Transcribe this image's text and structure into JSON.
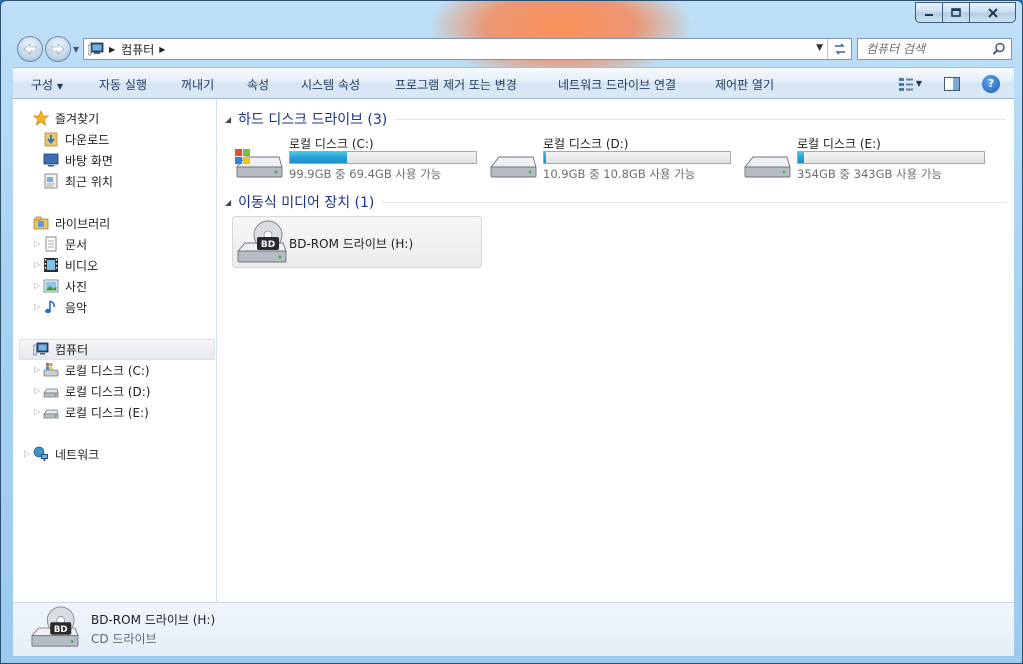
{
  "window": {
    "caption": {
      "minimize_icon": "minimize-icon",
      "maximize_icon": "maximize-icon",
      "close_icon": "close-icon"
    }
  },
  "address_bar": {
    "location": "컴퓨터",
    "icon": "computer-icon"
  },
  "search": {
    "placeholder": "컴퓨터 검색"
  },
  "toolbar": {
    "organize": "구성",
    "autoplay": "자동 실행",
    "eject": "꺼내기",
    "properties": "속성",
    "system_properties": "시스템 속성",
    "uninstall": "프로그램 제거 또는 변경",
    "map_network_drive": "네트워크 드라이브 연결",
    "control_panel": "제어판 열기"
  },
  "nav": {
    "favorites": {
      "label": "즐겨찾기",
      "items": [
        "다운로드",
        "바탕 화면",
        "최근 위치"
      ]
    },
    "libraries": {
      "label": "라이브러리",
      "items": [
        "문서",
        "비디오",
        "사진",
        "음악"
      ]
    },
    "computer": {
      "label": "컴퓨터",
      "items": [
        "로컬 디스크 (C:)",
        "로컬 디스크 (D:)",
        "로컬 디스크 (E:)"
      ]
    },
    "network": {
      "label": "네트워크"
    }
  },
  "groups": {
    "hard_drives": {
      "title": "하드 디스크 드라이브 (3)"
    },
    "removable": {
      "title": "이동식 미디어 장치 (1)"
    }
  },
  "drives": [
    {
      "name": "로컬 디스크 (C:)",
      "free_text": "99.9GB 중 69.4GB 사용 가능",
      "used_fraction": 0.305,
      "icon": "windows-drive-icon"
    },
    {
      "name": "로컬 디스크 (D:)",
      "free_text": "10.9GB 중 10.8GB 사용 가능",
      "used_fraction": 0.01,
      "icon": "hard-drive-icon"
    },
    {
      "name": "로컬 디스크 (E:)",
      "free_text": "354GB 중 343GB 사용 가능",
      "used_fraction": 0.03,
      "icon": "hard-drive-icon"
    }
  ],
  "removable": [
    {
      "name": "BD-ROM 드라이브 (H:)",
      "icon": "bd-rom-icon",
      "badge": "BD"
    }
  ],
  "details": {
    "name": "BD-ROM 드라이브 (H:)",
    "type": "CD 드라이브",
    "badge": "BD"
  },
  "colors": {
    "accent": "#26a0da",
    "group_title": "#1e3287"
  }
}
